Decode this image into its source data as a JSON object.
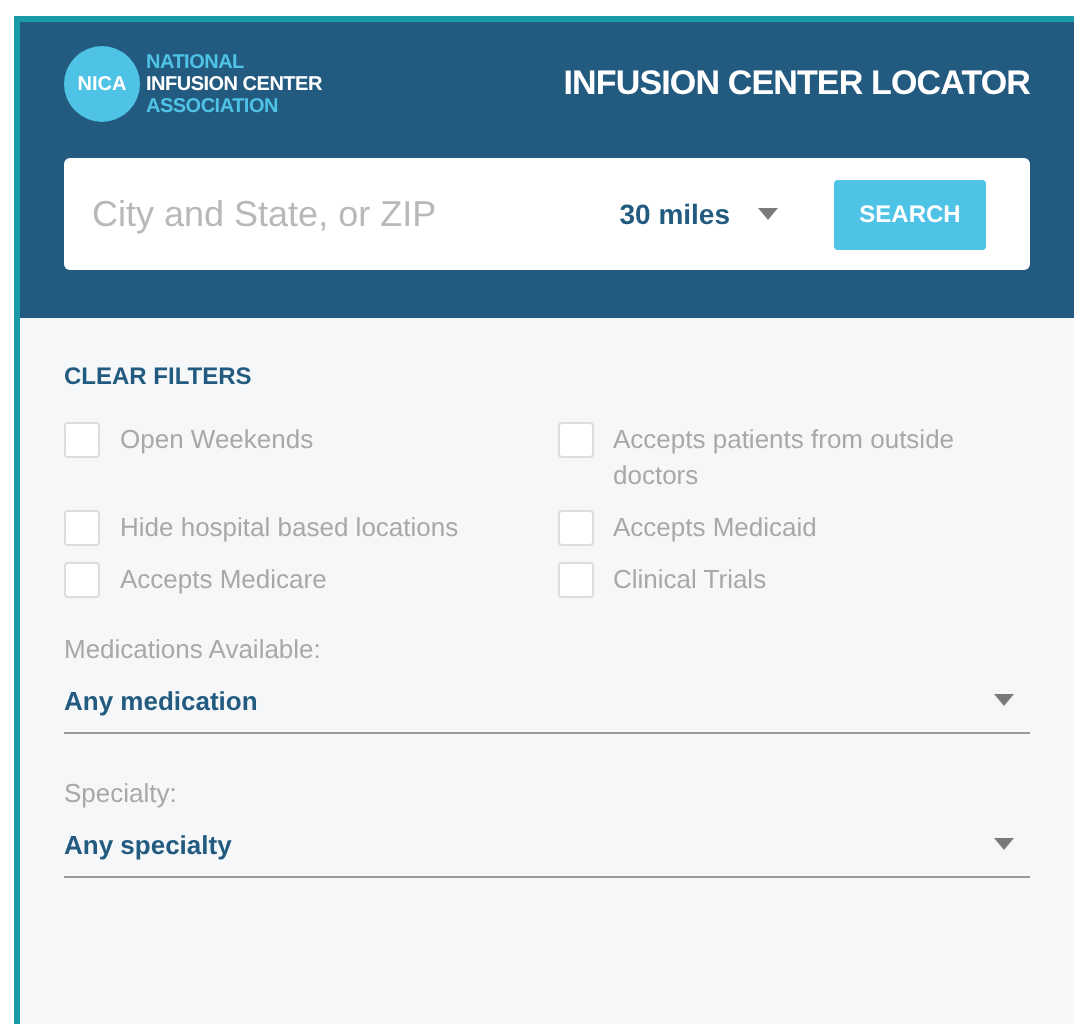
{
  "header": {
    "logo_mark": "NICA",
    "logo_lines": [
      {
        "text": "NATIONAL",
        "color": "#4fc3e6"
      },
      {
        "text": "INFUSION CENTER",
        "color": "#ffffff"
      },
      {
        "text": "ASSOCIATION",
        "color": "#4fc3e6"
      }
    ],
    "title": "INFUSION CENTER LOCATOR"
  },
  "search": {
    "placeholder": "City and State, or ZIP",
    "distance": "30 miles",
    "button": "SEARCH"
  },
  "filters": {
    "clear": "CLEAR FILTERS",
    "options": [
      {
        "label": "Open Weekends",
        "checked": false
      },
      {
        "label": "Accepts patients from outside doctors",
        "checked": false
      },
      {
        "label": "Hide hospital based locations",
        "checked": false
      },
      {
        "label": "Accepts Medicaid",
        "checked": false
      },
      {
        "label": "Accepts Medicare",
        "checked": false
      },
      {
        "label": "Clinical Trials",
        "checked": false
      }
    ]
  },
  "selects": [
    {
      "label": "Medications Available:",
      "value": "Any medication"
    },
    {
      "label": "Specialty:",
      "value": "Any specialty"
    }
  ]
}
